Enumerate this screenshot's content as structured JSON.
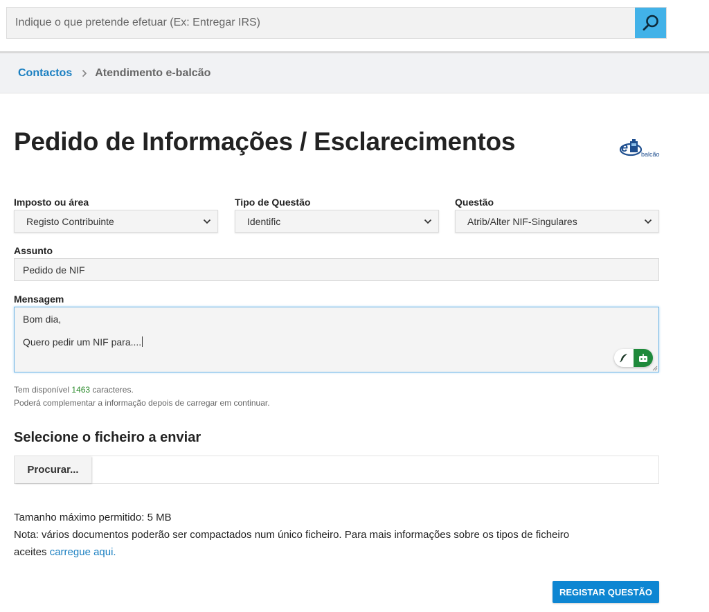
{
  "search": {
    "placeholder": "Indique o que pretende efetuar (Ex: Entregar IRS)"
  },
  "breadcrumb": {
    "home": "Contactos",
    "current": "Atendimento e-balcão"
  },
  "page": {
    "title": "Pedido de Informações / Esclarecimentos"
  },
  "form": {
    "imposto": {
      "label": "Imposto ou área",
      "value": "Registo Contribuinte"
    },
    "tipo": {
      "label": "Tipo de Questão",
      "value": "Identific"
    },
    "questao": {
      "label": "Questão",
      "value": "Atrib/Alter NIF-Singulares"
    },
    "assunto": {
      "label": "Assunto",
      "value": "Pedido de NIF"
    },
    "mensagem": {
      "label": "Mensagem",
      "line1": "Bom dia,",
      "line2": "Quero pedir um NIF para...."
    },
    "chars": {
      "prefix": "Tem disponível",
      "count": "1463",
      "suffix": "caracteres."
    },
    "note": "Poderá complementar a informação depois de carregar em continuar."
  },
  "upload": {
    "title": "Selecione o ficheiro a enviar",
    "browse": "Procurar...",
    "max_size": "Tamanho máximo permitido: 5 MB",
    "note_line1": "Nota: vários documentos poderão ser compactados num único ficheiro. Para mais informações sobre os tipos de ficheiro",
    "note_line2_prefix": "aceites",
    "note_link": "carregue aqui."
  },
  "submit": {
    "label": "REGISTAR QUESTÃO"
  },
  "logo": {
    "text": "balcão"
  },
  "colors": {
    "accent": "#0e86d2",
    "search_button": "#42b2e8",
    "count": "#2a8a2a",
    "ai_button": "#1f8a3b"
  }
}
